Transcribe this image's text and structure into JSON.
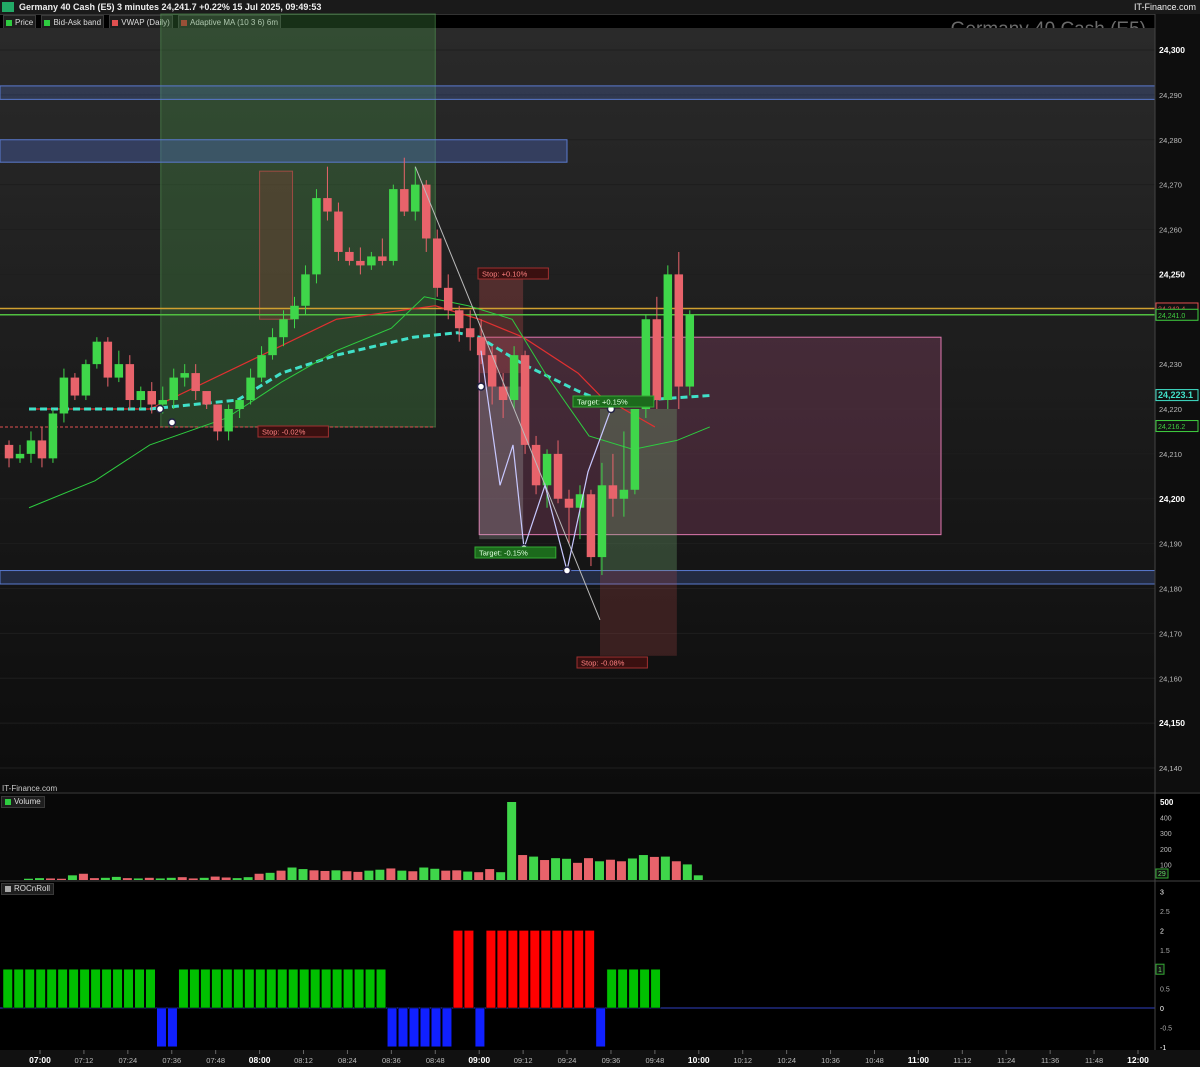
{
  "header": {
    "title": "Germany 40 Cash (E5) 3 minutes 24,241.7 +0.22% 15 Jul 2025, 09:49:53",
    "brand": "IT-Finance.com",
    "watermark": "Germany 40 Cash (E5)",
    "sub_brand": "IT-Finance.com"
  },
  "legend": [
    {
      "label": "Price",
      "color": "#2ecc40"
    },
    {
      "label": "Bid-Ask band",
      "color": "#2ecc40"
    },
    {
      "label": "VWAP (Daily)",
      "color": "#e05050"
    },
    {
      "label": "Adaptive MA (10 3 6) 6m",
      "color": "#2ecc40"
    }
  ],
  "colors": {
    "bull": "#3fd64a",
    "bear": "#e8636b",
    "vwap": "#e03030",
    "adaptive_ma": "#40e0c8",
    "bid_ask": "#2ecc40",
    "zone_blue": "#5a7ad0",
    "roc_green": "#00c000",
    "roc_red": "#ff0000",
    "roc_blue": "#1020ff"
  },
  "chart_data": [
    {
      "type": "candlestick",
      "title": "Germany 40 Cash (E5)",
      "timeframe": "3 minutes",
      "date": "15 Jul 2025",
      "ylim": [
        24131,
        24306
      ],
      "yticks": [
        24300,
        24290,
        24280,
        24270,
        24260,
        24250,
        24230,
        24220,
        24210,
        24200,
        24190,
        24180,
        24170,
        24160,
        24150,
        24140
      ],
      "xticks": [
        "07:00",
        "07:12",
        "07:24",
        "07:36",
        "07:48",
        "08:00",
        "08:12",
        "08:24",
        "08:36",
        "08:48",
        "09:00",
        "09:12",
        "09:24",
        "09:36",
        "09:48",
        "10:00",
        "10:12",
        "10:24",
        "10:36",
        "10:48",
        "11:00",
        "11:12",
        "11:24",
        "11:36",
        "11:48",
        "12:00"
      ],
      "bold_xticks": [
        "07:00",
        "08:00",
        "09:00",
        "10:00",
        "11:00",
        "12:00"
      ],
      "price_labels": [
        {
          "value": 24242.4,
          "text": "24,242.4",
          "color": "#e05050"
        },
        {
          "value": 24241.0,
          "text": "24,241.0",
          "color": "#40d040"
        },
        {
          "value": 24223.1,
          "text": "24,223.1",
          "color": "#40e0c8"
        },
        {
          "value": 24216.2,
          "text": "24,216.2",
          "color": "#40d040"
        }
      ],
      "candles": [
        [
          "06:57",
          24212,
          24213,
          24207,
          24209
        ],
        [
          "07:00",
          24209,
          24212,
          24208,
          24210
        ],
        [
          "07:03",
          24210,
          24215,
          24208,
          24213
        ],
        [
          "07:06",
          24213,
          24216,
          24207,
          24209
        ],
        [
          "07:09",
          24209,
          24220,
          24208,
          24219
        ],
        [
          "07:12",
          24219,
          24229,
          24217,
          24227
        ],
        [
          "07:15",
          24227,
          24228,
          24222,
          24223
        ],
        [
          "07:18",
          24223,
          24231,
          24222,
          24230
        ],
        [
          "07:21",
          24230,
          24236,
          24229,
          24235
        ],
        [
          "07:24",
          24235,
          24236,
          24225,
          24227
        ],
        [
          "07:27",
          24227,
          24233,
          24226,
          24230
        ],
        [
          "07:30",
          24230,
          24232,
          24220,
          24222
        ],
        [
          "07:33",
          24222,
          24225,
          24220,
          24224
        ],
        [
          "07:36",
          24224,
          24226,
          24219,
          24221
        ],
        [
          "07:39",
          24221,
          24225,
          24219,
          24222
        ],
        [
          "07:42",
          24222,
          24229,
          24220,
          24227
        ],
        [
          "07:45",
          24227,
          24230,
          24225,
          24228
        ],
        [
          "07:48",
          24228,
          24230,
          24222,
          24224
        ],
        [
          "07:51",
          24224,
          24223,
          24220,
          24221
        ],
        [
          "07:54",
          24221,
          24220,
          24213,
          24215
        ],
        [
          "07:57",
          24215,
          24221,
          24213,
          24220
        ],
        [
          "08:00",
          24220,
          24222,
          24218,
          24222
        ],
        [
          "08:03",
          24222,
          24229,
          24221,
          24227
        ],
        [
          "08:06",
          24227,
          24234,
          24226,
          24232
        ],
        [
          "08:09",
          24232,
          24238,
          24231,
          24236
        ],
        [
          "08:12",
          24236,
          24242,
          24234,
          24240
        ],
        [
          "08:15",
          24240,
          24245,
          24238,
          24243
        ],
        [
          "08:18",
          24243,
          24252,
          24241,
          24250
        ],
        [
          "08:21",
          24250,
          24269,
          24248,
          24267
        ],
        [
          "08:24",
          24267,
          24274,
          24262,
          24264
        ],
        [
          "08:27",
          24264,
          24266,
          24253,
          24255
        ],
        [
          "08:30",
          24255,
          24256,
          24252,
          24253
        ],
        [
          "08:33",
          24253,
          24256,
          24250,
          24252
        ],
        [
          "08:36",
          24252,
          24255,
          24251,
          24254
        ],
        [
          "08:39",
          24254,
          24258,
          24252,
          24253
        ],
        [
          "08:42",
          24253,
          24270,
          24252,
          24269
        ],
        [
          "08:45",
          24269,
          24276,
          24263,
          24264
        ],
        [
          "08:48",
          24264,
          24274,
          24262,
          24270
        ],
        [
          "08:51",
          24270,
          24271,
          24255,
          24258
        ],
        [
          "08:54",
          24258,
          24260,
          24245,
          24247
        ],
        [
          "08:57",
          24247,
          24250,
          24240,
          24242
        ],
        [
          "09:00",
          24242,
          24243,
          24235,
          24238
        ],
        [
          "09:03",
          24238,
          24242,
          24233,
          24236
        ],
        [
          "09:06",
          24236,
          24240,
          24230,
          24232
        ],
        [
          "09:09",
          24232,
          24234,
          24221,
          24225
        ],
        [
          "09:12",
          24225,
          24228,
          24218,
          24222
        ],
        [
          "09:15",
          24222,
          24234,
          24220,
          24232
        ],
        [
          "09:18",
          24232,
          24233,
          24210,
          24212
        ],
        [
          "09:21",
          24212,
          24214,
          24201,
          24203
        ],
        [
          "09:24",
          24203,
          24211,
          24198,
          24210
        ],
        [
          "09:27",
          24210,
          24213,
          24199,
          24200
        ],
        [
          "09:30",
          24200,
          24202,
          24190,
          24198
        ],
        [
          "09:33",
          24198,
          24203,
          24191,
          24201
        ],
        [
          "09:36",
          24201,
          24202,
          24185,
          24187
        ],
        [
          "09:39",
          24187,
          24208,
          24183,
          24203
        ],
        [
          "09:42",
          24203,
          24210,
          24196,
          24200
        ],
        [
          "09:45",
          24200,
          24215,
          24196,
          24202
        ],
        [
          "09:48",
          24202,
          24220,
          24201,
          24220
        ],
        [
          "09:51",
          24220,
          24241,
          24218,
          24240
        ],
        [
          "09:54",
          24240,
          24245,
          24220,
          24222
        ],
        [
          "09:57",
          24222,
          24252,
          24220,
          24250
        ],
        [
          "10:00",
          24250,
          24255,
          24220,
          24225
        ],
        [
          "10:03",
          24225,
          24242,
          24223,
          24241
        ]
      ],
      "vwap": [
        [
          "06:57",
          24220
        ],
        [
          "07:00",
          24220
        ]
      ],
      "zones": [
        {
          "from": 24292,
          "to": 24289
        },
        {
          "from": 24280,
          "to": 24275
        }
      ]
    },
    {
      "type": "bar",
      "title": "Volume",
      "ylim": [
        0,
        500
      ],
      "yticks": [
        500,
        400,
        300,
        200,
        100
      ],
      "last_value": "29"
    },
    {
      "type": "bar",
      "title": "ROCnRoll",
      "ylim": [
        -1,
        3
      ],
      "yticks": [
        "3",
        "2.5",
        "2",
        "1.5",
        "1",
        "0.5",
        "0",
        "-0.5",
        "-1"
      ],
      "last_value": "1"
    }
  ],
  "annotations": {
    "stop_1": "Stop: -0.02%",
    "stop_2": "Stop: +0.10%",
    "target_1": "Target: -0.15%",
    "target_2": "Target: +0.15%",
    "stop_3": "Stop: -0.08%"
  }
}
